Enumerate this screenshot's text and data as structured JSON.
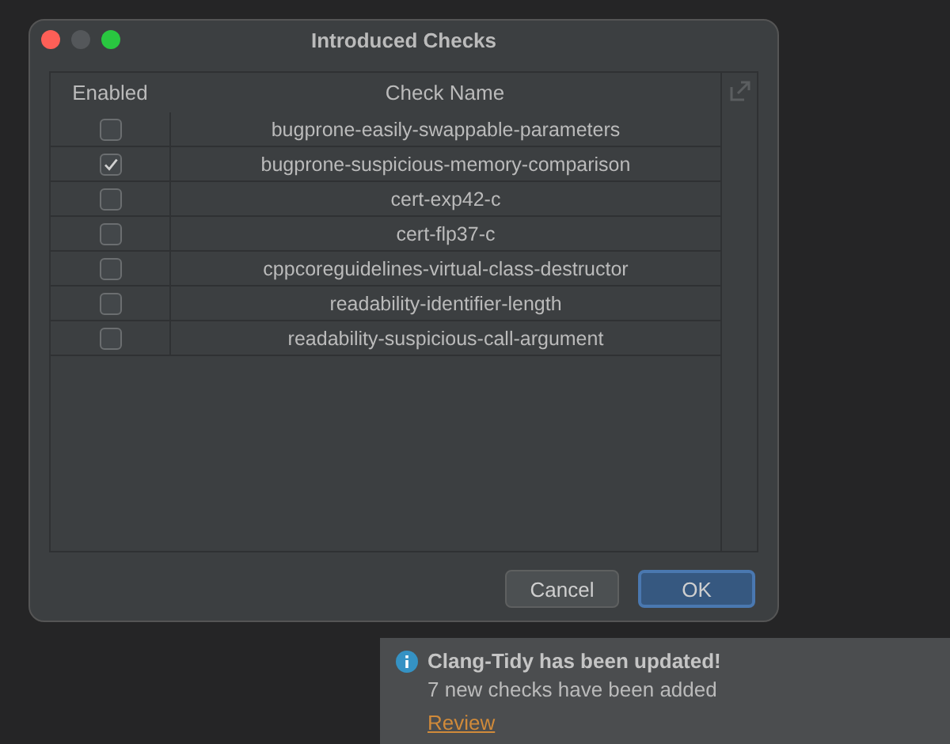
{
  "window": {
    "title": "Introduced Checks"
  },
  "table": {
    "columns": [
      "Enabled",
      "Check Name"
    ],
    "rows": [
      {
        "checked": false,
        "name": "bugprone-easily-swappable-parameters"
      },
      {
        "checked": true,
        "name": "bugprone-suspicious-memory-comparison"
      },
      {
        "checked": false,
        "name": "cert-exp42-c"
      },
      {
        "checked": false,
        "name": "cert-flp37-c"
      },
      {
        "checked": false,
        "name": "cppcoreguidelines-virtual-class-destructor"
      },
      {
        "checked": false,
        "name": "readability-identifier-length"
      },
      {
        "checked": false,
        "name": "readability-suspicious-call-argument"
      }
    ]
  },
  "buttons": [
    {
      "label": "Cancel",
      "kind": "secondary"
    },
    {
      "label": "OK",
      "kind": "primary"
    }
  ],
  "notification": {
    "title": "Clang-Tidy has been updated!",
    "message": "7 new checks have been added",
    "link": "Review"
  }
}
